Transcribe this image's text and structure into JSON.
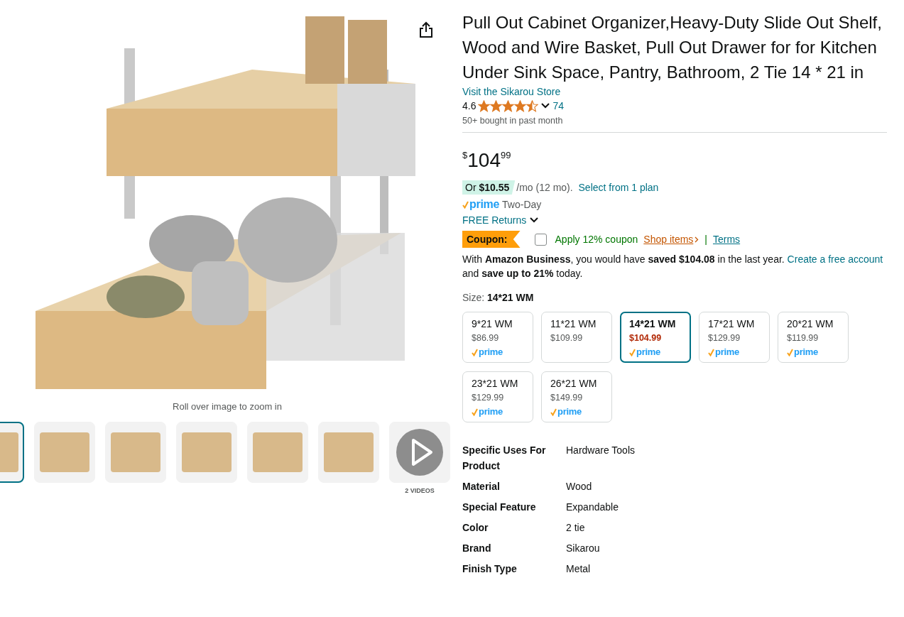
{
  "gallery": {
    "caption": "Roll over image to zoom in",
    "thumbnails": [
      {
        "kind": "image",
        "selected": true
      },
      {
        "kind": "image",
        "selected": false
      },
      {
        "kind": "image",
        "selected": false
      },
      {
        "kind": "image",
        "selected": false
      },
      {
        "kind": "image",
        "selected": false
      },
      {
        "kind": "image",
        "selected": false
      },
      {
        "kind": "video",
        "selected": false,
        "caption": "2 VIDEOS"
      }
    ]
  },
  "title": "Pull Out Cabinet Organizer,Heavy-Duty Slide Out Shelf, Wood and Wire Basket, Pull Out Drawer for for Kitchen Under Sink Space, Pantry, Bathroom, 2 Tie 14 * 21 in",
  "store_link": "Visit the Sikarou Store",
  "rating": {
    "value": "4.6",
    "stars": 4.5,
    "count": "74"
  },
  "bought": "50+ bought in past month",
  "price": {
    "symbol": "$",
    "whole": "104",
    "fraction": "99"
  },
  "financing": {
    "badge": "Or **$10.55**",
    "text": "/mo (12 mo).",
    "link": "Select from 1 plan"
  },
  "delivery": {
    "logo": "prime",
    "text": "Two-Day"
  },
  "returns": "FREE Returns",
  "coupon": {
    "badge": "Coupon:",
    "checked": false,
    "label": "Apply 12% coupon",
    "shop_link": "Shop items",
    "separator": "|",
    "terms_link": "Terms"
  },
  "business": {
    "before": "With **Amazon Business**, you would have **saved $104.08** in the last year.",
    "link": "Create a free account",
    "after": "and **save up to 21%** today."
  },
  "size": {
    "label": "Size:",
    "value": "14*21 WM",
    "options": [
      {
        "name": "9*21 WM",
        "price": "$86.99",
        "badge": "prime",
        "selected": false
      },
      {
        "name": "11*21 WM",
        "price": "$109.99",
        "selected": false
      },
      {
        "name": "14*21 WM",
        "price": "$104.99",
        "badge": "prime",
        "selected": true
      },
      {
        "name": "17*21 WM",
        "price": "$129.99",
        "badge": "prime",
        "selected": false
      },
      {
        "name": "20*21 WM",
        "price": "$119.99",
        "badge": "prime",
        "selected": false
      },
      {
        "name": "23*21 WM",
        "price": "$129.99",
        "badge": "prime",
        "selected": false
      },
      {
        "name": "26*21 WM",
        "price": "$149.99",
        "badge": "prime",
        "selected": false
      }
    ]
  },
  "specs": [
    {
      "label": "Specific Uses For Product",
      "value": "Hardware Tools"
    },
    {
      "label": "Material",
      "value": "Wood"
    },
    {
      "label": "Special Feature",
      "value": "Expandable"
    },
    {
      "label": "Color",
      "value": "2 tie"
    },
    {
      "label": "Brand",
      "value": "Sikarou"
    },
    {
      "label": "Finish Type",
      "value": "Metal"
    }
  ]
}
